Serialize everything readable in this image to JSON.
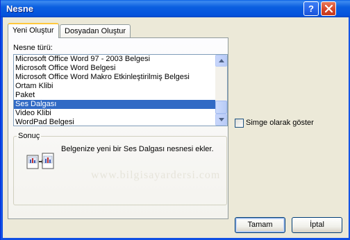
{
  "window": {
    "title": "Nesne",
    "help_button": "?"
  },
  "tabs": [
    {
      "label": "Yeni Oluştur",
      "active": true
    },
    {
      "label": "Dosyadan Oluştur",
      "active": false
    }
  ],
  "object_type": {
    "label": "Nesne türü:",
    "items": [
      "Microsoft Office Word 97 - 2003 Belgesi",
      "Microsoft Office Word Belgesi",
      "Microsoft Office Word Makro Etkinleştirilmiş Belgesi",
      "Ortam Klibi",
      "Paket",
      "Ses Dalgası",
      "Video Klibi",
      "WordPad Belgesi"
    ],
    "selected": "Ses Dalgası"
  },
  "display_as_icon": {
    "label": "Simge olarak göster",
    "checked": false
  },
  "result": {
    "title": "Sonuç",
    "text": "Belgenize yeni bir Ses Dalgası nesnesi ekler."
  },
  "watermark": "www.bilgisayardersi.com",
  "buttons": {
    "ok": "Tamam",
    "cancel": "İptal"
  },
  "colors": {
    "titlebar": "#0453dc",
    "selection": "#316ac5",
    "dialog_bg": "#ece9d8",
    "close_button": "#d6472a"
  }
}
